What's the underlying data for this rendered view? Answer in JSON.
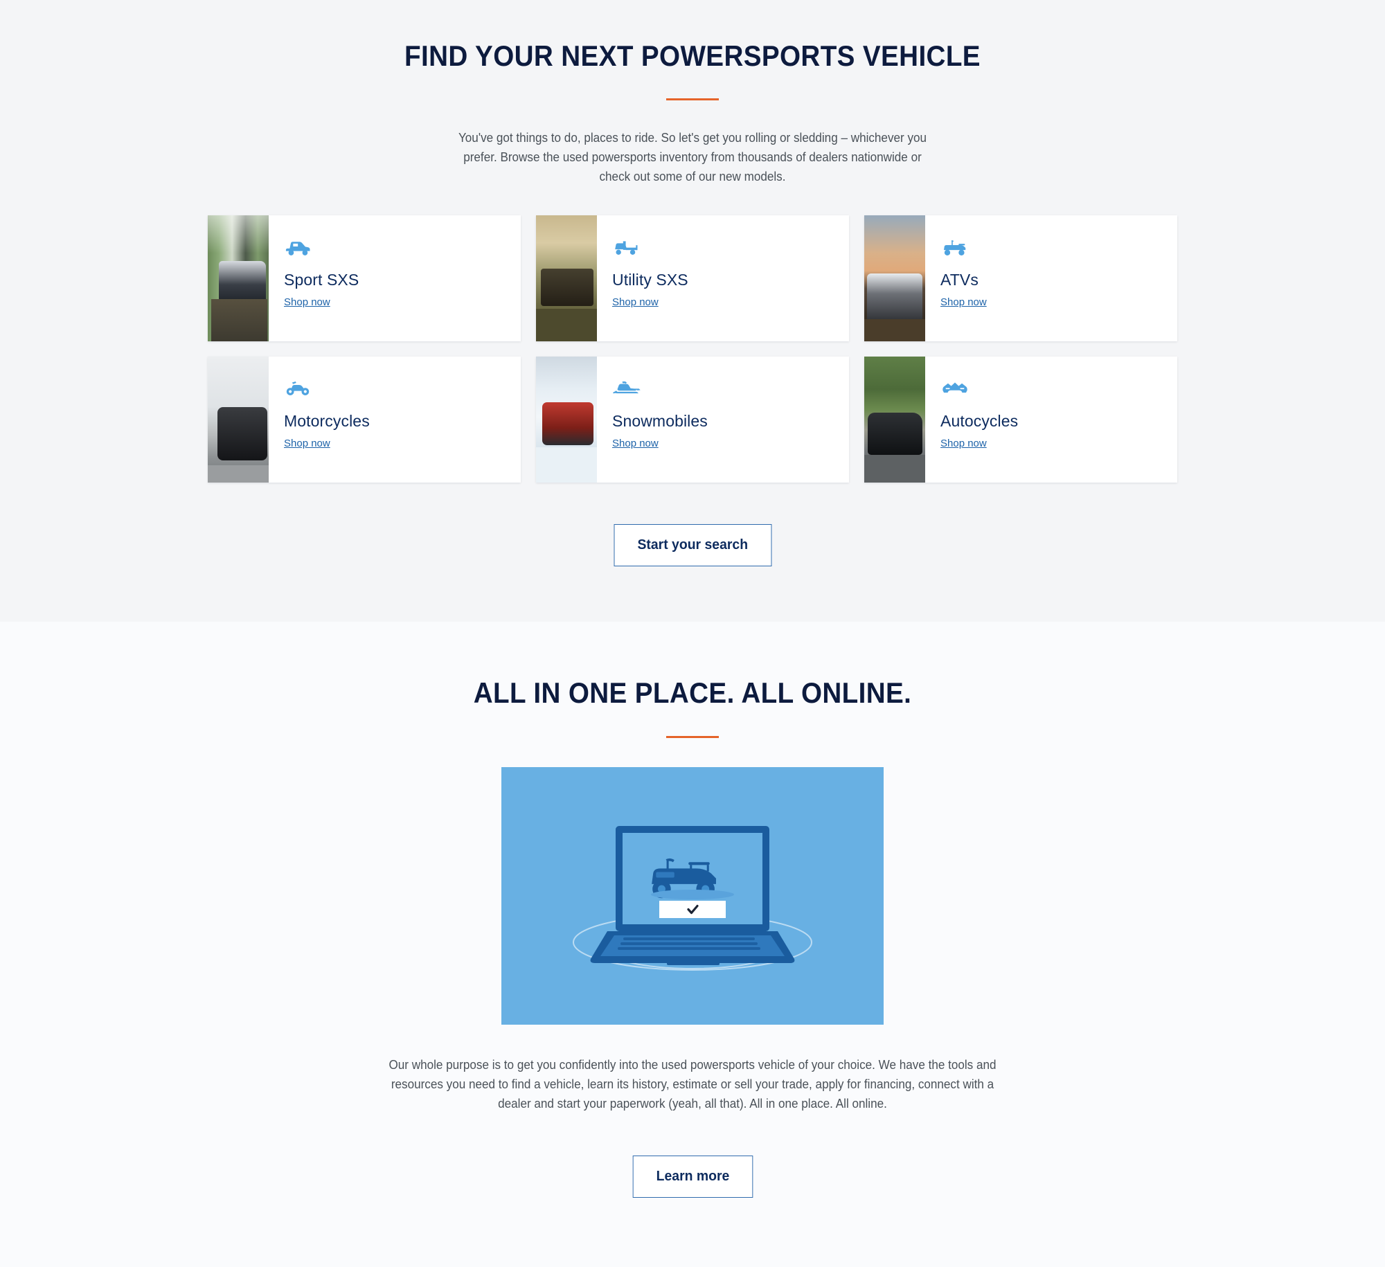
{
  "colors": {
    "navy": "#0d1b3e",
    "title_blue": "#0d2b5e",
    "link_blue": "#1d62a8",
    "accent_orange": "#e5642a",
    "icon_blue": "#4ea3e0",
    "illustration_bg": "#68b0e3",
    "section_bg_top": "#f4f5f7",
    "section_bg_bottom": "#fafbfd"
  },
  "find_section": {
    "heading": "FIND YOUR NEXT POWERSPORTS VEHICLE",
    "lede": "You've got things to do, places to ride. So let's get you rolling or sledding – whichever you prefer. Browse the used powersports inventory from thousands of dealers nationwide or check out some of our new models.",
    "cta_label": "Start your search",
    "cards": [
      {
        "title": "Sport SXS",
        "link_label": "Shop now",
        "icon": "sport-sxs-icon",
        "image": "sport-sxs-photo"
      },
      {
        "title": "Utility SXS",
        "link_label": "Shop now",
        "icon": "utility-sxs-icon",
        "image": "utility-sxs-photo"
      },
      {
        "title": "ATVs",
        "link_label": "Shop now",
        "icon": "atv-icon",
        "image": "atv-photo"
      },
      {
        "title": "Motorcycles",
        "link_label": "Shop now",
        "icon": "motorcycle-icon",
        "image": "motorcycle-photo"
      },
      {
        "title": "Snowmobiles",
        "link_label": "Shop now",
        "icon": "snowmobile-icon",
        "image": "snowmobile-photo"
      },
      {
        "title": "Autocycles",
        "link_label": "Shop now",
        "icon": "autocycle-icon",
        "image": "autocycle-photo"
      }
    ]
  },
  "all_section": {
    "heading": "ALL IN ONE PLACE. ALL ONLINE.",
    "illustration": "laptop-with-atv-illustration",
    "paragraph": "Our whole purpose is to get you confidently into the used powersports vehicle of your choice. We have the tools and resources you need to find a vehicle, learn its history, estimate or sell your trade, apply for financing, connect with a dealer and start your paperwork (yeah, all that). All in one place. All online.",
    "cta_label": "Learn more"
  }
}
